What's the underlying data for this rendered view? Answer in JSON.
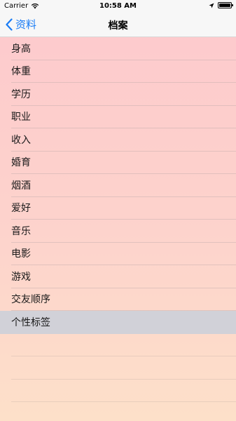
{
  "status_bar": {
    "carrier": "Carrier",
    "time": "10:58 AM",
    "icons": [
      "wifi-icon",
      "location-arrow-icon",
      "battery-icon"
    ]
  },
  "nav": {
    "back_label": "资料",
    "title": "档案"
  },
  "items": [
    {
      "label": "身高"
    },
    {
      "label": "体重"
    },
    {
      "label": "学历"
    },
    {
      "label": "职业"
    },
    {
      "label": "收入"
    },
    {
      "label": "婚育"
    },
    {
      "label": "烟酒"
    },
    {
      "label": "爱好"
    },
    {
      "label": "音乐"
    },
    {
      "label": "电影"
    },
    {
      "label": "游戏"
    },
    {
      "label": "交友顺序"
    },
    {
      "label": "个性标签"
    }
  ],
  "selected_item": "个性标签",
  "colors": {
    "accent": "#1a7cf5",
    "selected_row": "#d1d1d8",
    "background_top": "#fdc9cd",
    "background_bottom": "#fde0c9"
  }
}
